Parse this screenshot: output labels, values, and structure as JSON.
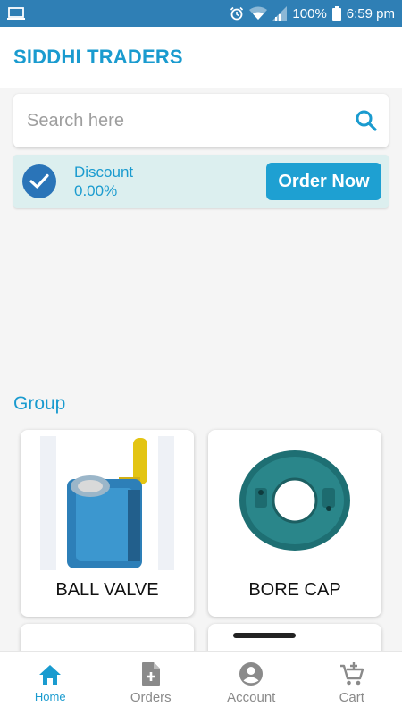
{
  "status_bar": {
    "battery": "100%",
    "time": "6:59 pm"
  },
  "app_bar": {
    "title": "SIDDHI TRADERS"
  },
  "search": {
    "placeholder": "Search here",
    "value": ""
  },
  "discount": {
    "label": "Discount",
    "value": "0.00%",
    "order_button": "Order Now"
  },
  "group": {
    "title": "Group",
    "items": [
      {
        "label": "BALL VALVE",
        "icon": "ball-valve-image"
      },
      {
        "label": "BORE CAP",
        "icon": "bore-cap-image"
      }
    ]
  },
  "bottom_nav": {
    "items": [
      {
        "label": "Home",
        "icon": "home-icon",
        "active": true
      },
      {
        "label": "Orders",
        "icon": "orders-icon",
        "active": false
      },
      {
        "label": "Account",
        "icon": "account-icon",
        "active": false
      },
      {
        "label": "Cart",
        "icon": "cart-icon",
        "active": false
      }
    ]
  },
  "colors": {
    "status_bar": "#2f7fb5",
    "accent": "#1a9bcf",
    "discount_bg": "#dcefef",
    "check_circle": "#2a74b8"
  }
}
